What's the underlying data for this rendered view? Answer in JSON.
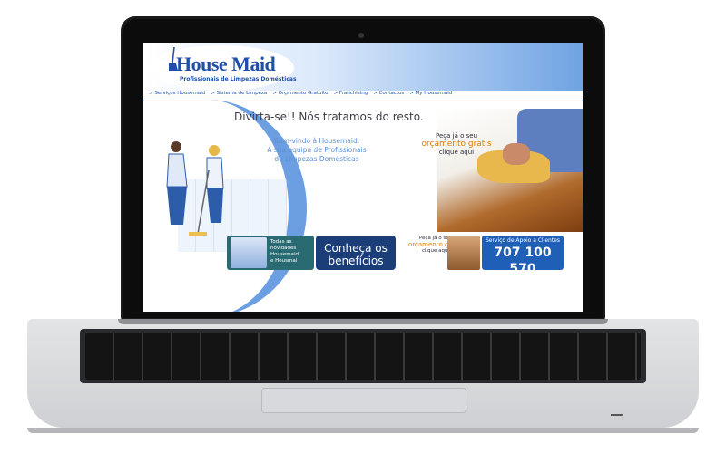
{
  "site": {
    "brand": "House Maid",
    "tagline": "Profissionais de Limpezas Domésticas",
    "nav": [
      "> Serviços Housemaid",
      "> Sistema de Limpeza",
      "> Orçamento Gratuito",
      "> Franchising",
      "> Contactos",
      "> My Housemaid"
    ],
    "headline": "Divirta-se!!  Nós tratamos do resto.",
    "welcome_lines": [
      "Bem-vindo à Housemaid.",
      "A sua equipa de Profissionais",
      "de Limpezas Domésticas"
    ],
    "quote_big": {
      "line1": "Peça já o seu",
      "accent": "orçamento grátis",
      "line2": "clique aqui"
    },
    "promo_text": [
      "Todas as",
      "novidades",
      "Housemaid",
      "e Housmai"
    ],
    "benefits_button": "Conheça os benefícios",
    "quote_small": {
      "line1": "Peça já o seu",
      "accent": "orçamento grátis",
      "line2": "clique aqui"
    },
    "support": {
      "label": "Serviço de Apoio a Clientes",
      "phone": "707 100 570"
    }
  },
  "colors": {
    "brand_blue": "#1f4fa6",
    "accent_orange": "#e07a00",
    "navy": "#1b3e79"
  }
}
